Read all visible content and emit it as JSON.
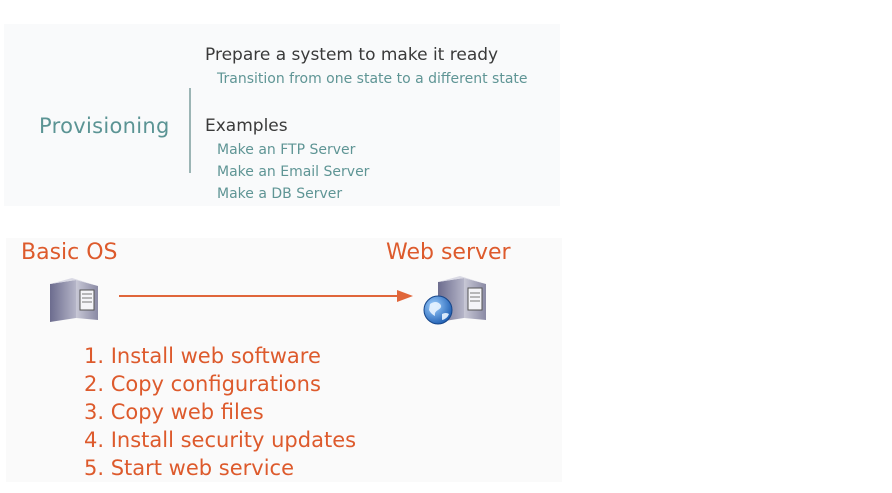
{
  "provisioning": {
    "title": "Provisioning",
    "definition": "Prepare a system to make it ready",
    "definition_detail": "Transition from one state to a different state",
    "examples_heading": "Examples",
    "examples": [
      "Make an FTP Server",
      "Make an Email Server",
      "Make a DB Server"
    ]
  },
  "diagram": {
    "source_label": "Basic OS",
    "target_label": "Web server",
    "source_icon": "server-icon",
    "target_icon": "web-server-globe-icon",
    "accent_color": "#dd5a2c",
    "teal_color": "#5b9494"
  },
  "steps": [
    "1. Install web software",
    "2. Copy configurations",
    "3. Copy web files",
    "4. Install security updates",
    "5. Start web service"
  ]
}
